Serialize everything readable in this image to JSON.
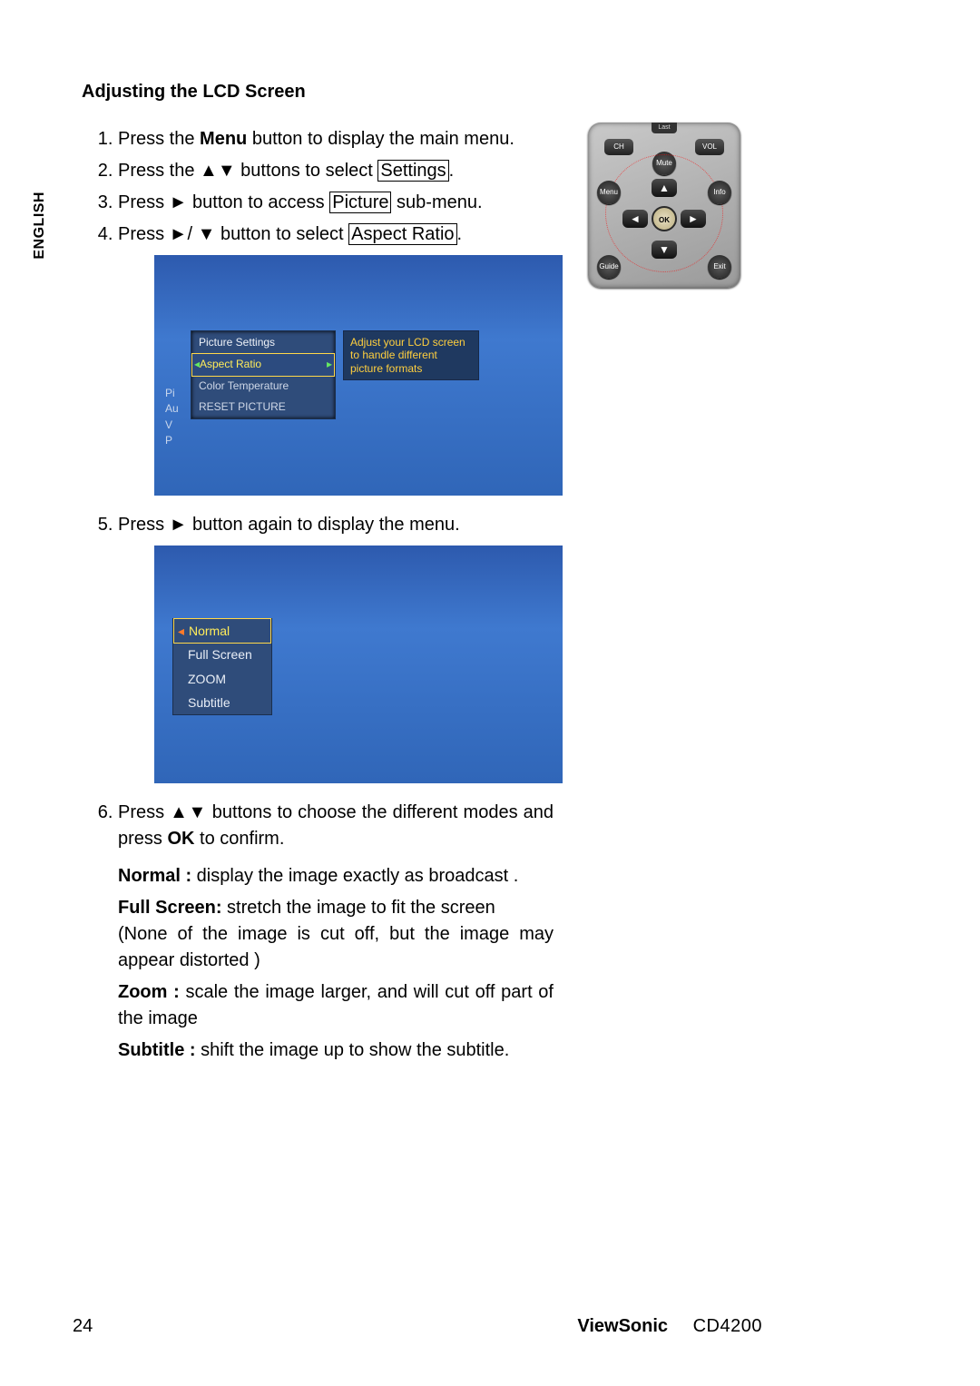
{
  "side_label": "ENGLISH",
  "heading": "Adjusting the LCD Screen",
  "steps": {
    "s1_pre": "Press the ",
    "s1_bold": "Menu",
    "s1_post": " button to display the main menu.",
    "s2_pre": "Press the ▲▼ buttons to select ",
    "s2_box": "Settings",
    "s2_post": ".",
    "s3_pre": "Press ► button to access ",
    "s3_box": "Picture",
    "s3_post": " sub-menu.",
    "s4_pre": "Press ►/ ▼ button to select ",
    "s4_box": "Aspect Ratio",
    "s4_post": ".",
    "s5": "Press ► button again to display the menu.",
    "s6_pre": "Press ▲▼ buttons to choose the different modes and press ",
    "s6_bold": "OK",
    "s6_post": " to confirm."
  },
  "osd1": {
    "title": "Picture Settings",
    "row_sel": "Aspect Ratio",
    "row2": "Color Temperature",
    "row3": "RESET PICTURE",
    "hint": "Adjust your LCD screen to handle different picture formats",
    "left_items": [
      "Pi",
      "Au",
      "V",
      "P"
    ]
  },
  "osd2": {
    "items": [
      "Normal",
      "Full Screen",
      "ZOOM",
      "Subtitle"
    ]
  },
  "desc": {
    "normal_label": "Normal :",
    "normal_text": " display the image exactly as broadcast .",
    "full_label": "Full Screen:",
    "full_text": " stretch the image to fit the screen",
    "full_extra": "(None of the image is cut off, but the image may appear distorted )",
    "zoom_label": "Zoom :",
    "zoom_text": " scale the image larger, and will cut off part of the image",
    "sub_label": "Subtitle :",
    "sub_text": " shift the image up to show the subtitle."
  },
  "remote": {
    "last": "Last",
    "ch": "CH",
    "vol": "VOL",
    "mute": "Mute",
    "menu": "Menu",
    "info": "Info",
    "guide": "Guide",
    "exit": "Exit",
    "ok": "OK",
    "up": "▲",
    "down": "▼",
    "left": "◄",
    "right": "►"
  },
  "footer": {
    "page": "24",
    "brand": "ViewSonic",
    "model": "CD4200"
  }
}
